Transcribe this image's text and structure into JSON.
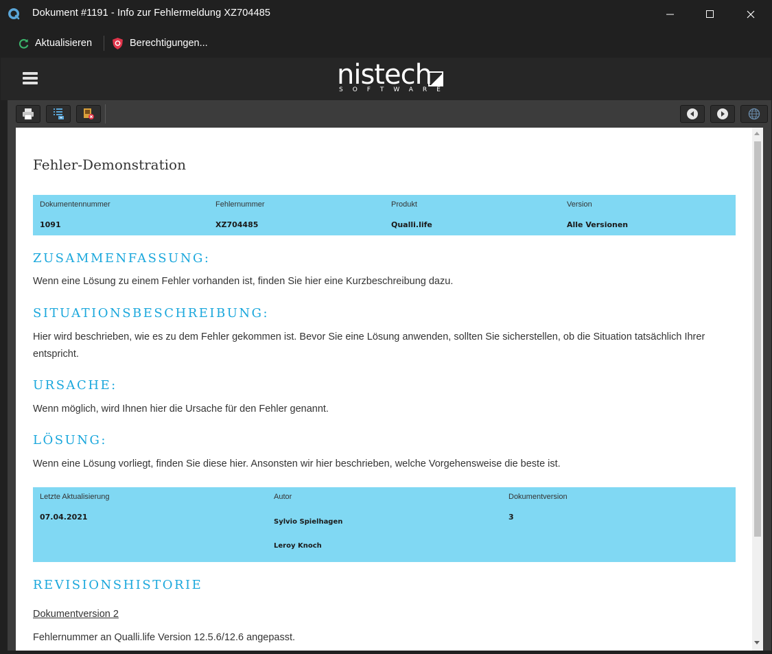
{
  "window": {
    "title": "Dokument #1191 - Info zur Fehlermeldung XZ704485",
    "controls": [
      "minimize",
      "maximize",
      "close"
    ]
  },
  "commands": {
    "refresh_label": "Aktualisieren",
    "permissions_label": "Berechtigungen..."
  },
  "header": {
    "logo_word": "nistech",
    "logo_sub": "SOFTWARE"
  },
  "toolbar": {
    "icons": [
      "print-icon",
      "list-dropdown-icon",
      "close-document-icon",
      "back-icon",
      "forward-icon",
      "globe-icon"
    ]
  },
  "document": {
    "title": "Fehler-Demonstration",
    "info1": {
      "doc_number_label": "Dokumentennummer",
      "doc_number_value": "1091",
      "error_number_label": "Fehlernummer",
      "error_number_value": "XZ704485",
      "product_label": "Produkt",
      "product_value": "Qualli.life",
      "version_label": "Version",
      "version_value": "Alle Versionen"
    },
    "sections": {
      "summary_heading": "ZUSAMMENFASSUNG:",
      "summary_text": "Wenn eine Lösung zu einem Fehler vorhanden ist, finden Sie hier eine Kurzbeschreibung dazu.",
      "situation_heading": "SITUATIONSBESCHREIBUNG:",
      "situation_text": "Hier wird beschrieben, wie es zu dem Fehler gekommen ist. Bevor Sie eine Lösung anwenden, sollten Sie sicherstellen, ob die Situation tatsächlich Ihrer entspricht.",
      "cause_heading": "URSACHE:",
      "cause_text": "Wenn möglich, wird Ihnen hier die Ursache für den Fehler genannt.",
      "solution_heading": "LÖSUNG:",
      "solution_text": "Wenn eine Lösung vorliegt, finden Sie diese hier. Ansonsten wir hier beschrieben, welche Vorgehensweise die beste ist."
    },
    "info2": {
      "updated_label": "Letzte Aktualisierung",
      "updated_value": "07.04.2021",
      "author_label": "Autor",
      "author_1": "Sylvio Spielhagen",
      "author_2": "Leroy Knoch",
      "docversion_label": "Dokumentversion",
      "docversion_value": "3"
    },
    "revision": {
      "heading": "REVISIONSHISTORIE",
      "version_link": "Dokumentversion 2",
      "note": "Fehlernummer an Qualli.life Version 12.5.6/12.6 angepasst."
    }
  },
  "colors": {
    "accent": "#1aa7dc",
    "info_box": "#80d8f3",
    "chrome": "#202020",
    "refresh_icon": "#3bb36b",
    "shield_icon": "#e0354b"
  }
}
